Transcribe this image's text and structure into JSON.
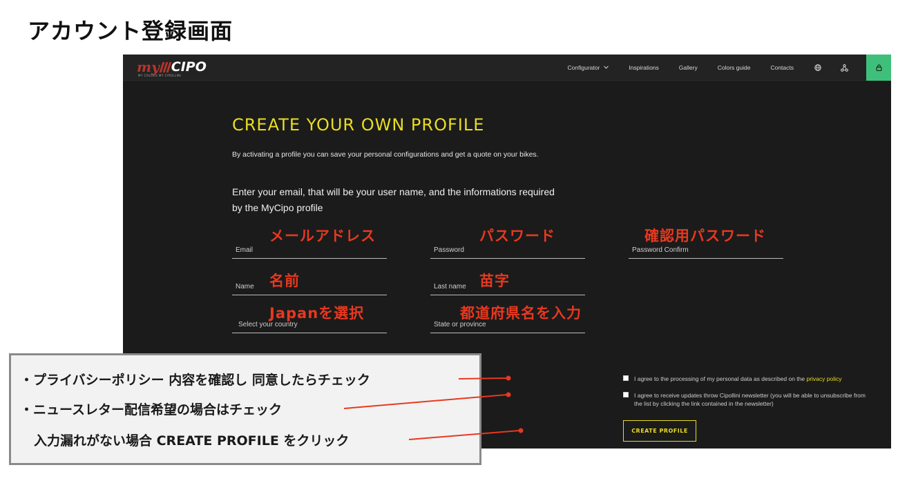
{
  "page_heading": "アカウント登録画面",
  "logo": {
    "main_my": "my",
    "main_cipo": "CIPO",
    "sub": "MY COLORS   MY CIPOLLINI"
  },
  "nav": {
    "items": [
      {
        "label": "Configurator",
        "has_dropdown": true
      },
      {
        "label": "Inspirations"
      },
      {
        "label": "Gallery"
      },
      {
        "label": "Colors guide"
      },
      {
        "label": "Contacts"
      }
    ],
    "icons": [
      "globe-icon",
      "share-icon",
      "lock-icon"
    ]
  },
  "form": {
    "title": "CREATE YOUR OWN PROFILE",
    "description": "By activating a profile you can save your personal configurations and get a quote on your bikes.",
    "intro": "Enter your email, that will be your user name, and the informations required by the MyCipo profile",
    "fields": {
      "email": "Email",
      "password": "Password",
      "password_confirm": "Password Confirm",
      "name": "Name",
      "last_name": "Last name",
      "country": "Select your country",
      "state": "State or province"
    },
    "privacy_text": "I agree to the processing of my personal data as described on the ",
    "privacy_link": "privacy policy",
    "newsletter_text": "I agree to receive updates throw Cipollini newsletter (you will be able to unsubscribe from the list by clicking the link contained in the newsletter)",
    "submit_label": "CREATE PROFILE"
  },
  "annotations": {
    "email": "メールアドレス",
    "password": "パスワード",
    "password_confirm": "確認用パスワード",
    "name": "名前",
    "last_name": "苗字",
    "country": "Japanを選択",
    "state": "都道府県名を入力"
  },
  "callout": {
    "line1": "・プライバシーポリシー 内容を確認し 同意したらチェック",
    "line2": "・ニュースレター配信希望の場合はチェック",
    "line3": "入力漏れがない場合 CREATE PROFILE をクリック"
  },
  "colors": {
    "accent_yellow": "#e9dd22",
    "annotation_red": "#e8381f",
    "lock_green": "#3fc07a",
    "background_dark": "#1b1b1b"
  }
}
